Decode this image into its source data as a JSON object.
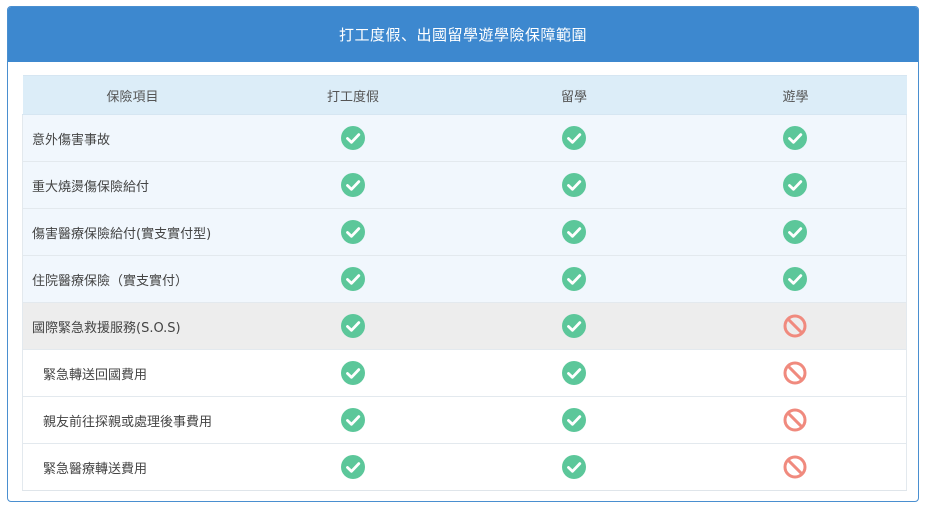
{
  "panel": {
    "title": "打工度假、出國留學遊學險保障範圍"
  },
  "table": {
    "headers": [
      "保險項目",
      "打工度假",
      "留學",
      "遊學"
    ],
    "rows": [
      {
        "label": "意外傷害事故",
        "style": "blue",
        "sub": false,
        "marks": [
          "check-icon",
          "check-icon",
          "check-icon"
        ]
      },
      {
        "label": "重大燒燙傷保險給付",
        "style": "blue",
        "sub": false,
        "marks": [
          "check-icon",
          "check-icon",
          "check-icon"
        ]
      },
      {
        "label": "傷害醫療保險給付(實支實付型)",
        "style": "blue",
        "sub": false,
        "marks": [
          "check-icon",
          "check-icon",
          "check-icon"
        ]
      },
      {
        "label": "住院醫療保險（實支實付）",
        "style": "blue",
        "sub": false,
        "marks": [
          "check-icon",
          "check-icon",
          "check-icon"
        ]
      },
      {
        "label": "國際緊急救援服務(S.O.S)",
        "style": "grey",
        "sub": false,
        "marks": [
          "check-icon",
          "check-icon",
          "prohibited-icon"
        ]
      },
      {
        "label": "緊急轉送回國費用",
        "style": "white",
        "sub": true,
        "marks": [
          "check-icon",
          "check-icon",
          "prohibited-icon"
        ]
      },
      {
        "label": "親友前往探親或處理後事費用",
        "style": "white",
        "sub": true,
        "marks": [
          "check-icon",
          "check-icon",
          "prohibited-icon"
        ]
      },
      {
        "label": "緊急醫療轉送費用",
        "style": "white",
        "sub": true,
        "marks": [
          "check-icon",
          "check-icon",
          "prohibited-icon"
        ]
      }
    ]
  },
  "colors": {
    "header_bg": "#3d88cf",
    "check": "#5cc79a",
    "prohibited": "#f08a7e"
  }
}
